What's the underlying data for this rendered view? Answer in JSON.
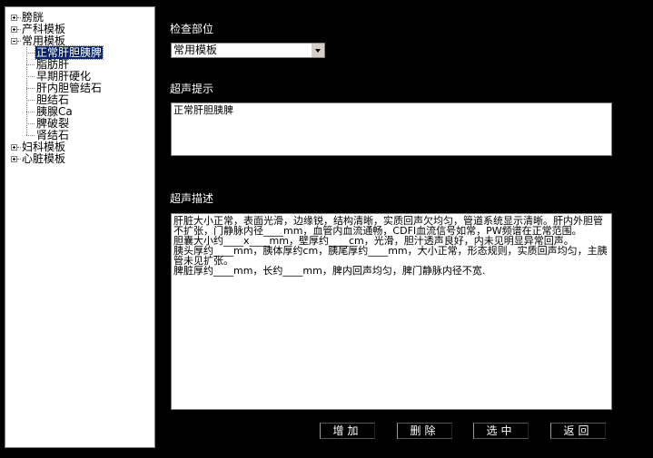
{
  "tree": {
    "roots": [
      {
        "label": "膀胱",
        "expanded": false
      },
      {
        "label": "产科模板",
        "expanded": false
      },
      {
        "label": "常用模板",
        "expanded": true,
        "children": [
          "正常肝胆胰脾",
          "脂肪肝",
          "早期肝硬化",
          "肝内胆管结石",
          "胆结石",
          "胰腺Ca",
          "脾破裂",
          "肾结石"
        ],
        "selected_child": 0
      },
      {
        "label": "妇科模板",
        "expanded": false
      },
      {
        "label": "心脏模板",
        "expanded": false
      }
    ]
  },
  "section_labels": {
    "location": "检查部位",
    "hint": "超声提示",
    "description": "超声描述"
  },
  "location_select": {
    "value": "常用模板"
  },
  "hint_text": "正常肝胆胰脾",
  "description_text": "肝脏大小正常，表面光滑，边缘锐，结构清晰，实质回声欠均匀，管道系统显示清晰。肝内外胆管不扩张，门静脉内径____mm，血管内血流通畅，CDFI血流信号如常，PW频谱在正常范围。\n胆囊大小约____x____mm，壁厚约____cm，光滑，胆汁透声良好，内未见明显异常回声。\n胰头厚约____mm，胰体厚约cm，胰尾厚约____mm，大小正常，形态规则，实质回声均匀，主胰管未见扩张。\n脾脏厚约____mm，长约____mm，脾内回声均匀，脾门静脉内径不宽.",
  "buttons": {
    "add": "增加",
    "delete": "删除",
    "select": "选中",
    "back": "返回"
  }
}
